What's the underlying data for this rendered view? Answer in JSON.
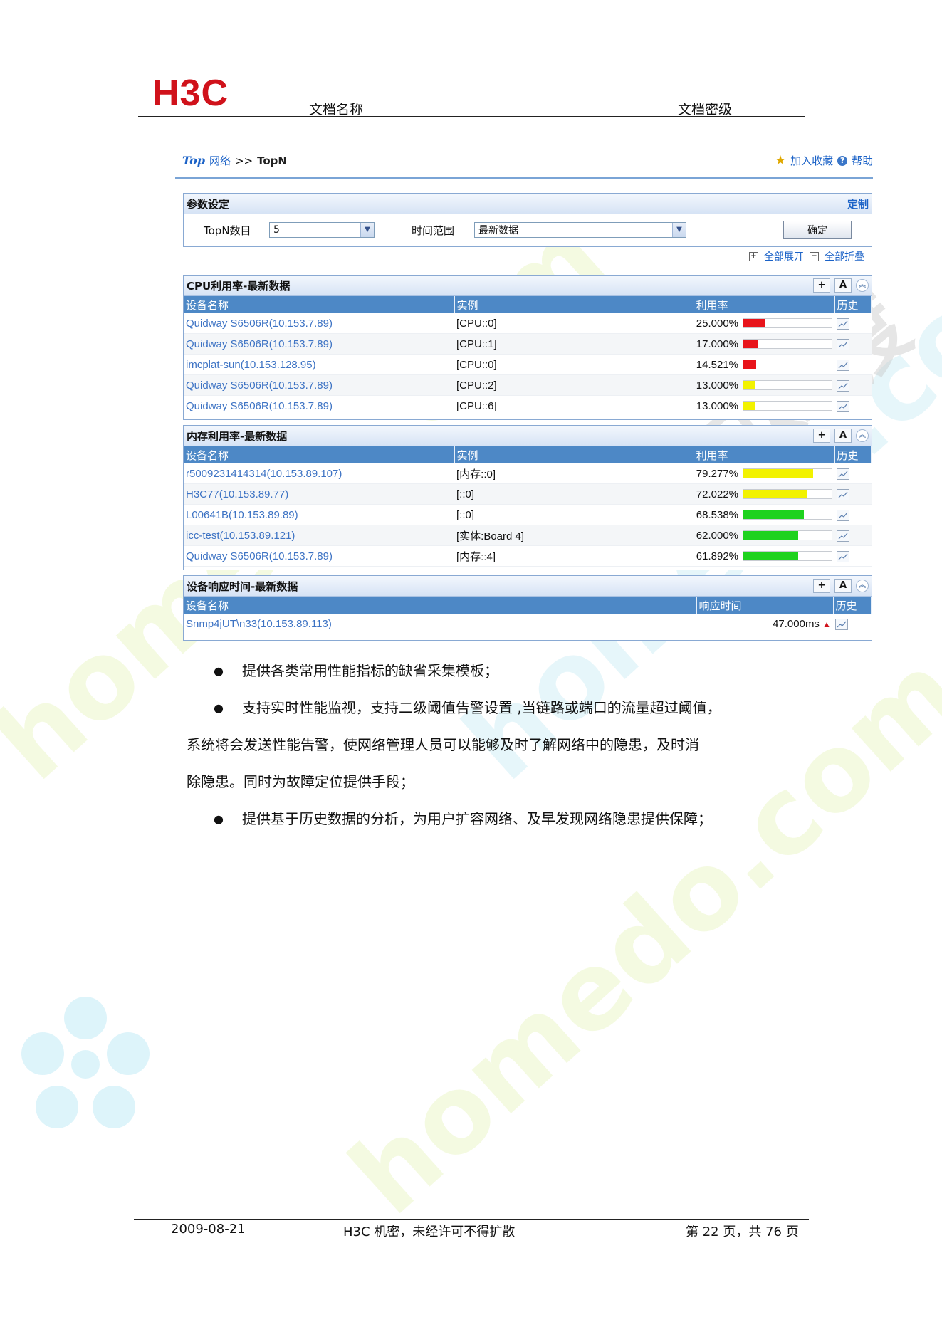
{
  "header": {
    "logo": "H3C",
    "doc_name": "文档名称",
    "doc_level": "文档密级"
  },
  "breadcrumb": {
    "logo_text": "Top",
    "section": "网络",
    "separator": ">>",
    "current": "TopN"
  },
  "top_links": {
    "favorite": "加入收藏",
    "help": "帮助"
  },
  "params": {
    "title": "参数设定",
    "customize": "定制",
    "topn_label": "TopN数目",
    "topn_value": "5",
    "range_label": "时间范围",
    "range_value": "最新数据",
    "ok": "确定"
  },
  "expand": {
    "expand_all": "全部展开",
    "collapse_all": "全部折叠"
  },
  "cpu": {
    "title": "CPU利用率-最新数据",
    "headers": [
      "设备名称",
      "实例",
      "利用率",
      "历史"
    ],
    "rows": [
      {
        "device": "Quidway S6506R(10.153.7.89)",
        "instance": "[CPU::0]",
        "rate": "25.000%",
        "pct": 25,
        "color": "#e8141b"
      },
      {
        "device": "Quidway S6506R(10.153.7.89)",
        "instance": "[CPU::1]",
        "rate": "17.000%",
        "pct": 17,
        "color": "#e8141b"
      },
      {
        "device": "imcplat-sun(10.153.128.95)",
        "instance": "[CPU::0]",
        "rate": "14.521%",
        "pct": 14.521,
        "color": "#e8141b"
      },
      {
        "device": "Quidway S6506R(10.153.7.89)",
        "instance": "[CPU::2]",
        "rate": "13.000%",
        "pct": 13,
        "color": "#f2f200"
      },
      {
        "device": "Quidway S6506R(10.153.7.89)",
        "instance": "[CPU::6]",
        "rate": "13.000%",
        "pct": 13,
        "color": "#f2f200"
      }
    ]
  },
  "mem": {
    "title": "内存利用率-最新数据",
    "headers": [
      "设备名称",
      "实例",
      "利用率",
      "历史"
    ],
    "rows": [
      {
        "device": "r5009231414314(10.153.89.107)",
        "instance": "[内存::0]",
        "rate": "79.277%",
        "pct": 79.277,
        "color": "#f2f200"
      },
      {
        "device": "H3C77(10.153.89.77)",
        "instance": "[::0]",
        "rate": "72.022%",
        "pct": 72.022,
        "color": "#f2f200"
      },
      {
        "device": "L00641B(10.153.89.89)",
        "instance": "[::0]",
        "rate": "68.538%",
        "pct": 68.538,
        "color": "#1ed21e"
      },
      {
        "device": "icc-test(10.153.89.121)",
        "instance": "[实体:Board 4]",
        "rate": "62.000%",
        "pct": 62,
        "color": "#1ed21e"
      },
      {
        "device": "Quidway S6506R(10.153.7.89)",
        "instance": "[内存::4]",
        "rate": "61.892%",
        "pct": 61.892,
        "color": "#1ed21e"
      }
    ]
  },
  "resp": {
    "title": "设备响应时间-最新数据",
    "headers": [
      "设备名称",
      "响应时间",
      "历史"
    ],
    "rows": [
      {
        "device": "Snmp4jUT\\n33(10.153.89.113)",
        "time": "47.000ms"
      }
    ]
  },
  "body": {
    "bullet1": "提供各类常用性能指标的缺省采集模板；",
    "bullet2_line1": "支持实时性能监视，支持二级阈值告警设置 ,当链路或端口的流量超过阈值，",
    "bullet2_line2": "系统将会发送性能告警，使网络管理人员可以能够及时了解网络中的隐患，及时消",
    "bullet2_line3": "除隐患。同时为故障定位提供手段；",
    "bullet3": "提供基于历史数据的分析，为用户扩容网络、及早发现网络隐患提供保障；"
  },
  "footer": {
    "date": "2009-08-21",
    "notice": "H3C 机密，未经许可不得扩散",
    "page": "第 22 页，共 76 页"
  },
  "watermark": {
    "text": "homedo.com",
    "brand": "河姆渡"
  }
}
